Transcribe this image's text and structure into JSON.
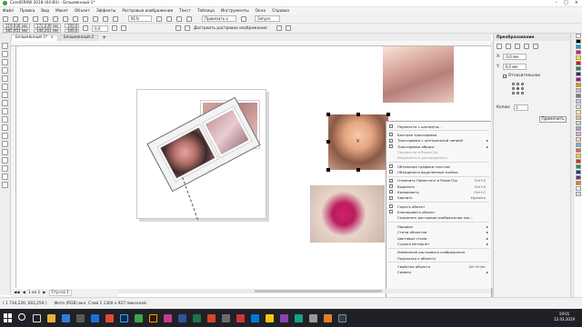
{
  "window": {
    "title": "CorelDRAW 2018 (64-Bit) - Безымянный-1*"
  },
  "menu": [
    "Файл",
    "Правка",
    "Вид",
    "Макет",
    "Объект",
    "Эффекты",
    "Растровые изображения",
    "Текст",
    "Таблица",
    "Инструменты",
    "Окно",
    "Справка"
  ],
  "toolbar": {
    "zoom": "81%",
    "snap_label": "Привязать к",
    "launch_label": "Запуск"
  },
  "propbar": {
    "x": "119,936 мм",
    "y": "385,951 мм",
    "w": "172,039 мм",
    "h": "146,261 мм",
    "sx": "100,0",
    "sy": "100,0",
    "angle": "0,0",
    "mode_label": "Достроить растровое изображение"
  },
  "doctabs": [
    {
      "label": "Безымянный-1*",
      "active": true
    },
    {
      "label": "Безымянный-2",
      "active": false
    }
  ],
  "pagetabs": {
    "page_label": "Стр-на 1",
    "counter": "1 из 1"
  },
  "context_menu": [
    {
      "label": "Перенести с шагом/на...",
      "shortcut": "",
      "submenu": false,
      "disabled": false,
      "icon": true
    },
    {
      "sep": true
    },
    {
      "label": "Быстрая трассировка",
      "shortcut": "",
      "submenu": false,
      "disabled": false,
      "icon": true
    },
    {
      "label": "Трассировка с центральной линией",
      "shortcut": "",
      "submenu": true,
      "disabled": false,
      "icon": true
    },
    {
      "label": "Трассировка абриса",
      "shortcut": "",
      "submenu": true,
      "disabled": false,
      "icon": true
    },
    {
      "label": "Перевести в PowerClip",
      "shortcut": "",
      "submenu": false,
      "disabled": true,
      "icon": false
    },
    {
      "label": "Выровнять и распределить",
      "shortcut": "",
      "submenu": false,
      "disabled": true,
      "icon": false
    },
    {
      "sep": true
    },
    {
      "label": "Обтекание графики текстом",
      "shortcut": "",
      "submenu": false,
      "disabled": false,
      "icon": true
    },
    {
      "label": "Объединить выделенные ячейки",
      "shortcut": "",
      "submenu": false,
      "disabled": false,
      "icon": true
    },
    {
      "sep": true
    },
    {
      "label": "Отменить Поместить в PowerClip",
      "shortcut": "Ctrl+Z",
      "submenu": false,
      "disabled": false,
      "icon": true
    },
    {
      "label": "Вырезать",
      "shortcut": "Ctrl+X",
      "submenu": false,
      "disabled": false,
      "icon": true
    },
    {
      "label": "Копировать",
      "shortcut": "Ctrl+C",
      "submenu": false,
      "disabled": false,
      "icon": true
    },
    {
      "label": "Удалить",
      "shortcut": "Удалить",
      "submenu": false,
      "disabled": false,
      "icon": true
    },
    {
      "sep": true
    },
    {
      "label": "Скрыть объект",
      "shortcut": "",
      "submenu": false,
      "disabled": false,
      "icon": true
    },
    {
      "label": "Блокировать объект",
      "shortcut": "",
      "submenu": false,
      "disabled": false,
      "icon": true
    },
    {
      "label": "Сохранить растровое изображение как...",
      "shortcut": "",
      "submenu": false,
      "disabled": false,
      "icon": false
    },
    {
      "sep": true
    },
    {
      "label": "Порядок",
      "shortcut": "",
      "submenu": true,
      "disabled": false,
      "icon": false
    },
    {
      "label": "Стили объектов",
      "shortcut": "",
      "submenu": true,
      "disabled": false,
      "icon": false
    },
    {
      "label": "Цветовые стили",
      "shortcut": "",
      "submenu": true,
      "disabled": false,
      "icon": false
    },
    {
      "label": "Ссылка Интернет",
      "shortcut": "",
      "submenu": true,
      "disabled": false,
      "icon": false
    },
    {
      "sep": true
    },
    {
      "label": "Изменение растрового изображения",
      "shortcut": "",
      "submenu": false,
      "disabled": false,
      "icon": false
    },
    {
      "label": "Подсказка к объекту",
      "shortcut": "",
      "submenu": false,
      "disabled": false,
      "icon": false
    },
    {
      "sep": true
    },
    {
      "label": "Свойства объекта",
      "shortcut": "Alt+Enter",
      "submenu": false,
      "disabled": false,
      "icon": false
    },
    {
      "label": "Символ",
      "shortcut": "",
      "submenu": true,
      "disabled": false,
      "icon": false
    }
  ],
  "docker": {
    "title": "Преобразование",
    "x_value": "0,0 мм",
    "y_value": "0,0 мм",
    "relative_label": "Относительное",
    "copies_label": "Копии:",
    "copies_value": "1",
    "apply_label": "Применить"
  },
  "palette": [
    "#ffffff",
    "#000000",
    "#00a0e3",
    "#e4007f",
    "#ffed00",
    "#e30613",
    "#009640",
    "#312783",
    "#951b81",
    "#f39200",
    "#c8c8c8",
    "#7a7a7a",
    "#b2d1e5",
    "#fdd5e0",
    "#fff799",
    "#f5b1a0",
    "#bfdcad",
    "#a8a4d0",
    "#d9a9ce",
    "#fcd5a5",
    "#6fb3d6",
    "#e75480",
    "#ffd500",
    "#c0392b",
    "#2e8b57",
    "#1f3a93",
    "#6c3483",
    "#e67e22",
    "#f0f0f0",
    "#d8d8d8"
  ],
  "status": {
    "coords": "( 1 734,226; 602,259 )",
    "info": "Фото (RGB) вкл. Слой 1 1300 x 927 пикселей"
  },
  "taskbar": {
    "time": "19:01",
    "date": "12.03.2019"
  },
  "icons": [
    "windows-logo-icon",
    "search-icon",
    "close-icon",
    "minimize-icon",
    "maximize-icon"
  ]
}
